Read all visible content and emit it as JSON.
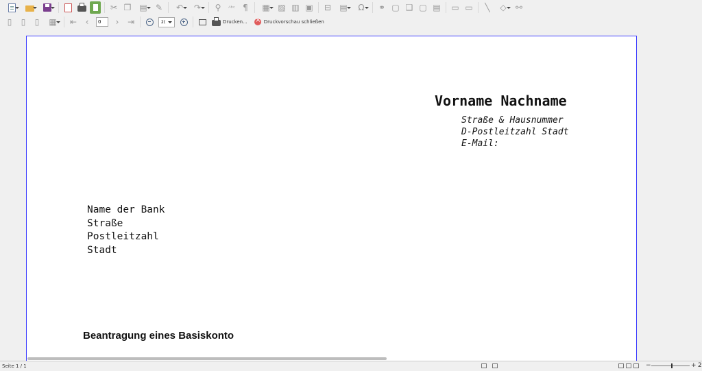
{
  "toolbar_standard": {
    "icons": [
      "new-document-icon",
      "open-folder-icon",
      "save-icon",
      "export-pdf-icon",
      "print-icon",
      "toggle-print-preview-icon",
      "cut-icon",
      "copy-icon",
      "paste-icon",
      "clone-formatting-icon",
      "undo-icon",
      "redo-icon",
      "find-replace-icon",
      "spelling-icon",
      "formatting-marks-icon",
      "insert-table-icon",
      "insert-image-icon",
      "insert-chart-icon",
      "insert-textbox-icon",
      "insert-page-break-icon",
      "insert-field-icon",
      "insert-special-character-icon",
      "hyperlink-icon",
      "footnote-icon",
      "endnote-icon",
      "bookmark-icon",
      "cross-reference-icon",
      "comment-icon",
      "track-changes-icon",
      "insert-line-icon",
      "basic-shapes-icon",
      "draw-functions-icon"
    ]
  },
  "preview_toolbar": {
    "page_value": "0",
    "zoom_value": "2(",
    "print_label": "Drucken...",
    "close_preview_label": "Druckvorschau schließen"
  },
  "letter": {
    "sender_name": "Vorname Nachname",
    "sender_street": "Straße & Hausnummer",
    "sender_city": "D-Postleitzahl Stadt",
    "sender_email": "E-Mail:",
    "recipient_bank": "Name der Bank",
    "recipient_street": "Straße",
    "recipient_zip": "Postleitzahl",
    "recipient_city": "Stadt",
    "subject": "Beantragung eines Basiskonto"
  },
  "statusbar": {
    "page_info": "Seite 1 / 1",
    "zoom_minus": "−",
    "zoom_plus": "+",
    "zoom_percent": "2"
  }
}
